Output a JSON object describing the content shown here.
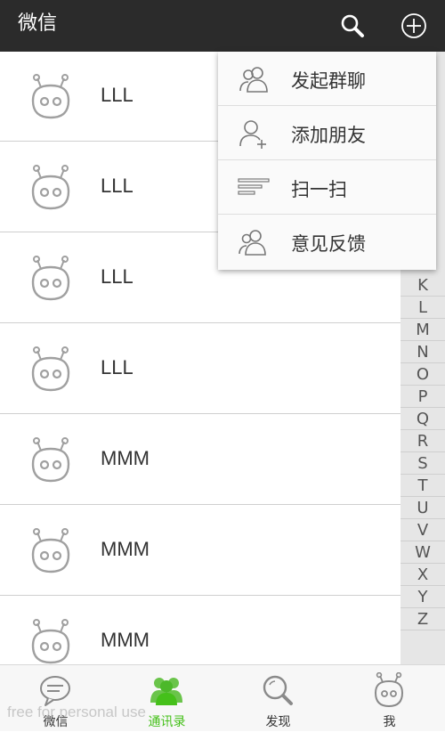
{
  "header": {
    "title": "微信",
    "icons": {
      "search": "search-icon",
      "add": "plus-circle-icon"
    }
  },
  "contacts": [
    {
      "name": "LLL",
      "icon": "robot-avatar-icon"
    },
    {
      "name": "LLL",
      "icon": "robot-avatar-icon"
    },
    {
      "name": "LLL",
      "icon": "robot-avatar-icon"
    },
    {
      "name": "LLL",
      "icon": "robot-avatar-icon"
    },
    {
      "name": "MMM",
      "icon": "robot-avatar-icon"
    },
    {
      "name": "MMM",
      "icon": "robot-avatar-icon"
    },
    {
      "name": "MMM",
      "icon": "robot-avatar-icon"
    }
  ],
  "index_letters": [
    "K",
    "L",
    "M",
    "N",
    "O",
    "P",
    "Q",
    "R",
    "S",
    "T",
    "U",
    "V",
    "W",
    "X",
    "Y",
    "Z"
  ],
  "menu": {
    "items": [
      {
        "label": "发起群聊",
        "icon": "group-chat-icon"
      },
      {
        "label": "添加朋友",
        "icon": "add-friend-icon"
      },
      {
        "label": "扫一扫",
        "icon": "scan-icon"
      },
      {
        "label": "意见反馈",
        "icon": "feedback-icon"
      }
    ]
  },
  "tabs": [
    {
      "label": "微信",
      "icon": "chat-bubble-icon",
      "active": false
    },
    {
      "label": "通讯录",
      "icon": "contacts-icon",
      "active": true
    },
    {
      "label": "发现",
      "icon": "discover-search-icon",
      "active": false
    },
    {
      "label": "我",
      "icon": "me-robot-icon",
      "active": false
    }
  ],
  "watermark": "free for personal use",
  "colors": {
    "topbar": "#2b2b2b",
    "accent": "#45c01a",
    "index_bg": "#e6e6e6"
  }
}
